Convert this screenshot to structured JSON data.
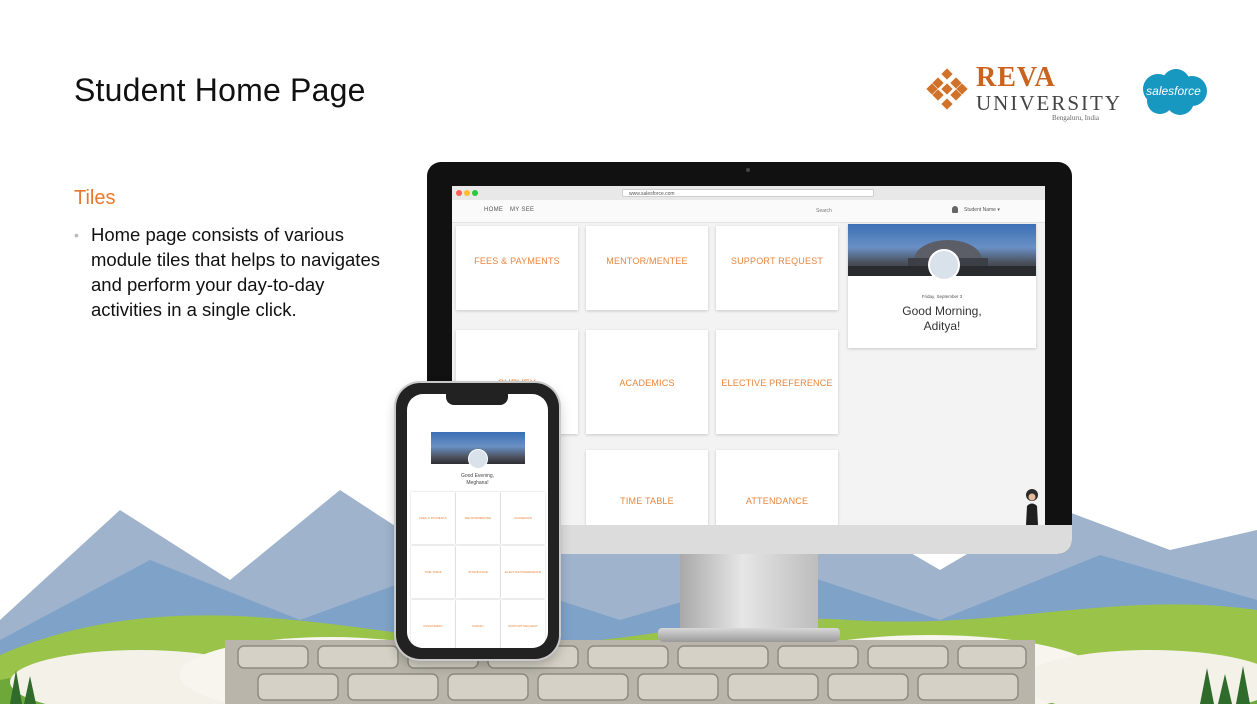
{
  "slide": {
    "title": "Student Home Page",
    "section_heading": "Tiles",
    "bullet": "Home page consists of various module tiles that helps to navigates and perform your day-to-day activities in a single click."
  },
  "logos": {
    "reva_name": "REVA",
    "reva_sub": "UNIVERSITY",
    "reva_location": "Bengaluru, India",
    "salesforce": "salesforce"
  },
  "desktop": {
    "url": "www.salesforce.com",
    "nav": [
      "HOME",
      "MY SEE"
    ],
    "search_placeholder": "Search",
    "user": "Student Name ▾",
    "tiles": [
      "FEES & PAYMENTS",
      "MENTOR/MENTEE",
      "SUPPORT REQUEST",
      "SURVEY",
      "ACADEMICS",
      "ELECTIVE PREFERENCE",
      "TIME TABLE",
      "ATTENDANCE"
    ],
    "profile": {
      "date": "Friday, September 3",
      "greeting_line1": "Good Morning,",
      "greeting_line2": "Aditya!"
    }
  },
  "phone": {
    "greeting_line1": "Good Evening,",
    "greeting_line2": "Meghana!",
    "tiles": [
      "FEES & PAYMENTS",
      "MENTOR/MENTEE",
      "ACADEMICS",
      "TIME TABLE",
      "ATTENDANCE",
      "ELECTIVE PREFERENCE",
      "ASSIGNMENT",
      "SURVEY",
      "SUPPORT REQUEST"
    ]
  },
  "colors": {
    "accent_orange": "#e8782e",
    "tile_text": "#e8853a",
    "reva_orange": "#c9631d",
    "salesforce_blue": "#1798c1"
  }
}
